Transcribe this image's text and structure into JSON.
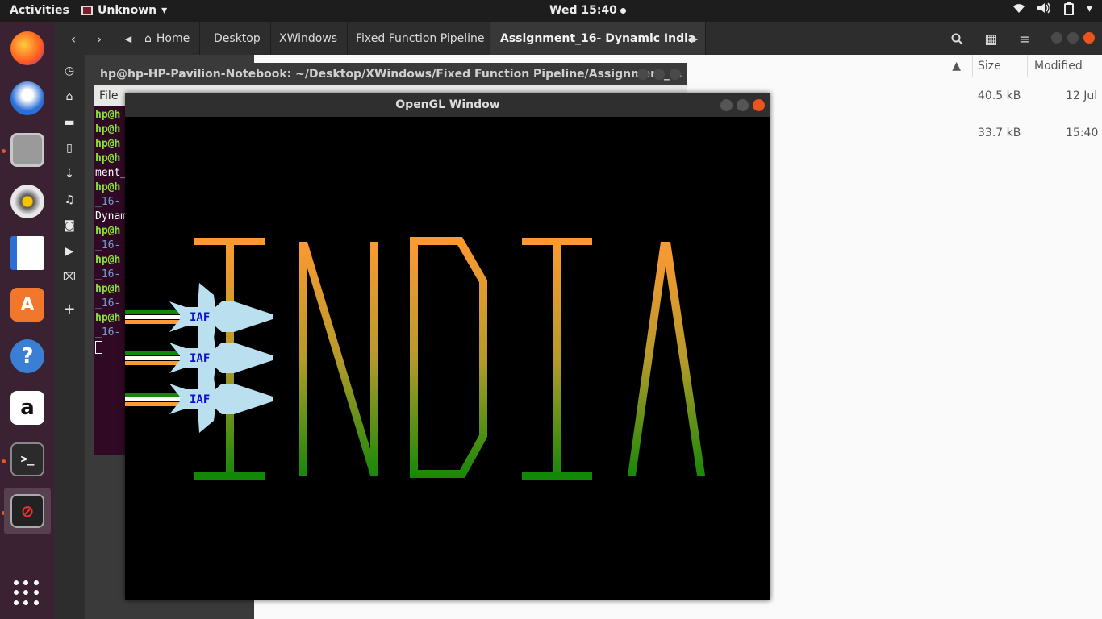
{
  "topbar": {
    "activities": "Activities",
    "app_name": "Unknown",
    "clock": "Wed 15:40"
  },
  "dock": {
    "items": [
      "firefox-icon",
      "thunderbird-icon",
      "files-icon",
      "rhythmbox-icon",
      "writer-icon",
      "software-icon",
      "help-icon",
      "amazon-icon",
      "terminal-icon",
      "opengl-app-icon"
    ]
  },
  "file_manager": {
    "breadcrumbs": [
      "Home",
      "Desktop",
      "XWindows",
      "Fixed Function Pipeline",
      "Assignment_16- Dynamic India"
    ],
    "columns": {
      "size": "Size",
      "modified": "Modified"
    },
    "rows": [
      {
        "size": "40.5 kB",
        "modified": "12 Jul"
      },
      {
        "size": "33.7 kB",
        "modified": "15:40"
      }
    ]
  },
  "terminal": {
    "title": "hp@hp-HP-Pavilion-Notebook: ~/Desktop/XWindows/Fixed Function Pipeline/Assignment_...",
    "menu": "File",
    "lines": [
      {
        "user": "hp@h",
        "path": "",
        "text": ""
      },
      {
        "user": "hp@h",
        "path": "",
        "text": ""
      },
      {
        "user": "hp@h",
        "path": "",
        "text": ""
      },
      {
        "user": "hp@h",
        "path": "",
        "text": ""
      },
      {
        "user": "",
        "path": "",
        "text": "ment_"
      },
      {
        "user": "hp@h",
        "path": "",
        "text": ""
      },
      {
        "user": "",
        "path": "_16-",
        "text": ""
      },
      {
        "user": "",
        "path": "",
        "text": "Dynam"
      },
      {
        "user": "hp@h",
        "path": "",
        "text": ""
      },
      {
        "user": "",
        "path": "_16-",
        "text": ""
      },
      {
        "user": "hp@h",
        "path": "",
        "text": ""
      },
      {
        "user": "",
        "path": "_16-",
        "text": ""
      },
      {
        "user": "hp@h",
        "path": "",
        "text": ""
      },
      {
        "user": "",
        "path": "_16-",
        "text": ""
      },
      {
        "user": "hp@h",
        "path": "",
        "text": ""
      },
      {
        "user": "",
        "path": "_16-",
        "text": ""
      }
    ]
  },
  "opengl_window": {
    "title": "OpenGL Window",
    "plane_label": "IAF",
    "colors": {
      "saffron": "#ff9933",
      "white": "#ffffff",
      "green": "#138808",
      "plane": "#bae0f0",
      "label": "#1010cc"
    }
  }
}
